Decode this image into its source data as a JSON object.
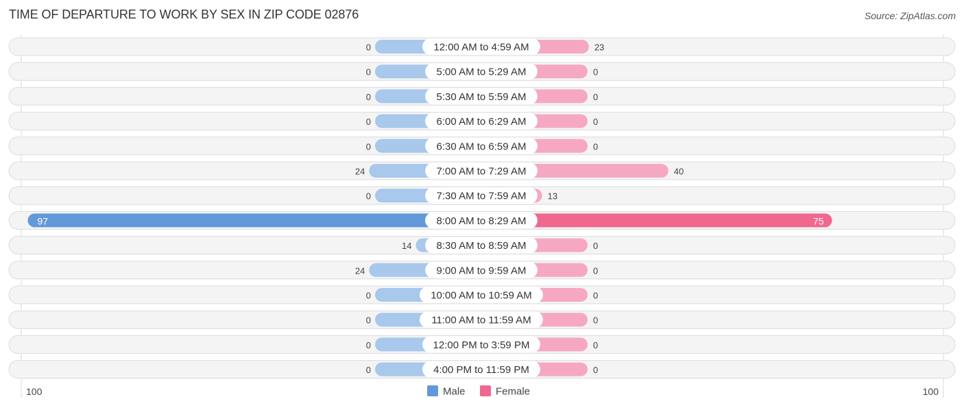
{
  "header": {
    "title": "TIME OF DEPARTURE TO WORK BY SEX IN ZIP CODE 02876",
    "source": "Source: ZipAtlas.com"
  },
  "colors": {
    "male_light": "#a8c8ec",
    "male_strong": "#6399d9",
    "female_light": "#f6a8c2",
    "female_strong": "#f06890",
    "row_bg": "#f4f4f4"
  },
  "chart_data": {
    "type": "bar",
    "orientation": "horizontal-diverging",
    "title": "TIME OF DEPARTURE TO WORK BY SEX IN ZIP CODE 02876",
    "categories": [
      "12:00 AM to 4:59 AM",
      "5:00 AM to 5:29 AM",
      "5:30 AM to 5:59 AM",
      "6:00 AM to 6:29 AM",
      "6:30 AM to 6:59 AM",
      "7:00 AM to 7:29 AM",
      "7:30 AM to 7:59 AM",
      "8:00 AM to 8:29 AM",
      "8:30 AM to 8:59 AM",
      "9:00 AM to 9:59 AM",
      "10:00 AM to 10:59 AM",
      "11:00 AM to 11:59 AM",
      "12:00 PM to 3:59 PM",
      "4:00 PM to 11:59 PM"
    ],
    "series": [
      {
        "name": "Male",
        "side": "left",
        "values": [
          0,
          0,
          0,
          0,
          0,
          24,
          0,
          97,
          14,
          24,
          0,
          0,
          0,
          0
        ]
      },
      {
        "name": "Female",
        "side": "right",
        "values": [
          23,
          0,
          0,
          0,
          0,
          40,
          13,
          75,
          0,
          0,
          0,
          0,
          0,
          0
        ]
      }
    ],
    "axis": {
      "left_label": "100",
      "right_label": "100",
      "range": [
        100,
        100
      ]
    },
    "legend": {
      "placement": "bottom-center",
      "items": [
        "Male",
        "Female"
      ]
    },
    "grid": false
  }
}
